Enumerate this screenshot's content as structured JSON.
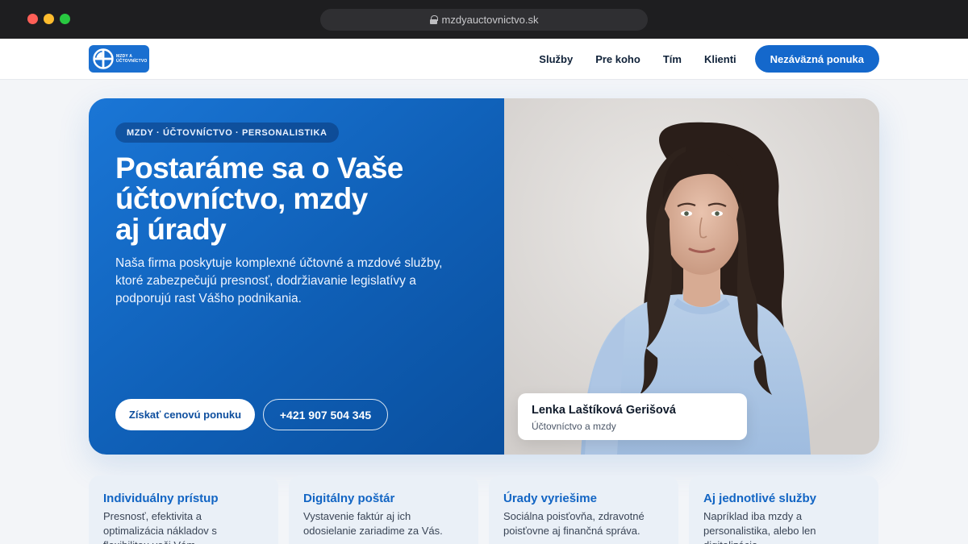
{
  "browser": {
    "url": "mzdyauctovnictvo.sk"
  },
  "header": {
    "logo": {
      "text_line1": "MZDY A",
      "text_line2": "ÚČTOVNÍCTVO"
    },
    "nav": [
      {
        "label": "Služby"
      },
      {
        "label": "Pre koho"
      },
      {
        "label": "Tím"
      },
      {
        "label": "Klienti"
      }
    ],
    "cta_label": "Nezáväzná ponuka"
  },
  "hero": {
    "badge": "MZDY · ÚČTOVNÍCTVO · PERSONALISTIKA",
    "title_lines": [
      "Postaráme sa o Vaše",
      "účtovníctvo, mzdy",
      "aj úrady"
    ],
    "text": "Naša firma poskytuje komplexné účtovné a mzdové služby, ktoré zabezpečujú presnosť, dodržiavanie legislatívy a podporujú rast Vášho podnikania.",
    "primary_button": "Získať cenovú ponuku",
    "phone_button": "+421 907 504 345",
    "person": {
      "name": "Lenka Laštíková Gerišová",
      "role": "Účtovníctvo a mzdy"
    }
  },
  "features": [
    {
      "title": "Individuálny prístup",
      "text": "Presnosť, efektivita a optimalizácia nákladov s flexibilitou voči Vám."
    },
    {
      "title": "Digitálny poštár",
      "text": "Vystavenie faktúr aj ich odosielanie zariadime za Vás."
    },
    {
      "title": "Úrady vyriešime",
      "text": "Sociálna poisťovňa, zdravotné poisťovne aj finančná správa."
    },
    {
      "title": "Aj jednotlivé služby",
      "text": "Napríklad iba mzdy a personalistika, alebo len digitalizácia."
    }
  ],
  "colors": {
    "brand_blue": "#1468cc",
    "hero_gradient_start": "#1a76d6",
    "hero_gradient_end": "#0a4f9e",
    "feature_title": "#1265c4"
  }
}
